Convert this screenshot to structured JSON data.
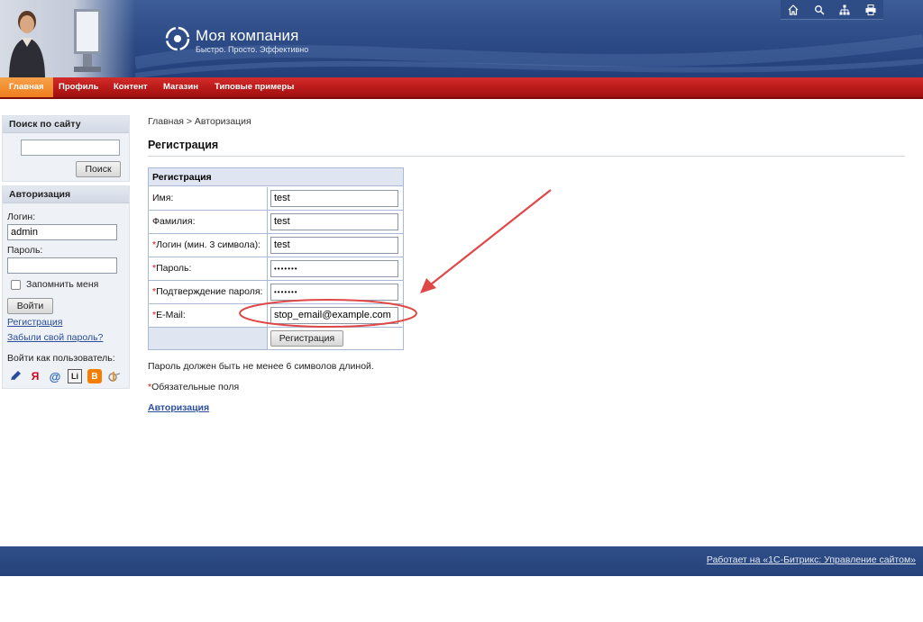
{
  "header": {
    "brand_name": "Моя компания",
    "slogan": "Быстро. Просто. Эффективно",
    "icons": [
      "home-icon",
      "search-icon",
      "sitemap-icon",
      "print-icon"
    ]
  },
  "menu": {
    "items": [
      "Главная",
      "Профиль",
      "Контент",
      "Магазин",
      "Типовые примеры"
    ],
    "active": "Главная"
  },
  "sidebar": {
    "search": {
      "title": "Поиск по сайту",
      "button": "Поиск"
    },
    "auth": {
      "title": "Авторизация",
      "login_label": "Логин:",
      "login_value": "admin",
      "password_label": "Пароль:",
      "remember_label": "Запомнить меня",
      "login_button": "Войти",
      "register_link": "Регистрация",
      "forgot_link": "Забыли свой пароль?",
      "login_as": "Войти как пользователь:",
      "social": [
        "livejournal-icon",
        "yandex-icon",
        "mailru-icon",
        "liveinternet-icon",
        "blogger-icon",
        "openid-icon"
      ]
    }
  },
  "main": {
    "breadcrumb": "Главная > Авторизация",
    "title": "Регистрация",
    "form": {
      "header": "Регистрация",
      "fields": [
        {
          "label": "Имя:",
          "value": "test",
          "required": false
        },
        {
          "label": "Фамилия:",
          "value": "test",
          "required": false
        },
        {
          "label": "Логин (мин. 3 символа):",
          "value": "test",
          "required": true
        },
        {
          "label": "Пароль:",
          "value": "•••••••",
          "required": true
        },
        {
          "label": "Подтверждение пароля:",
          "value": "•••••••",
          "required": true
        },
        {
          "label": "E-Mail:",
          "value": "stop_email@example.com",
          "required": true
        }
      ],
      "submit": "Регистрация"
    },
    "password_note": "Пароль должен быть не менее 6 символов длиной.",
    "required_note": "Обязательные поля",
    "auth_link": "Авторизация"
  },
  "footer": {
    "text": "Работает на «1С-Битрикс: Управление сайтом»"
  },
  "colors": {
    "header": "#2c4a85",
    "menu": "#b71818",
    "menu_active": "#ee7d1d",
    "annotation": "#e04848"
  }
}
